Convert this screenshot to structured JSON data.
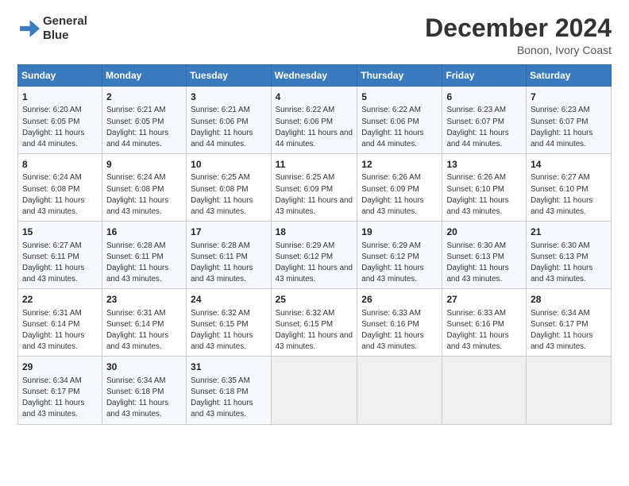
{
  "logo": {
    "line1": "General",
    "line2": "Blue"
  },
  "title": "December 2024",
  "subtitle": "Bonon, Ivory Coast",
  "days_header": [
    "Sunday",
    "Monday",
    "Tuesday",
    "Wednesday",
    "Thursday",
    "Friday",
    "Saturday"
  ],
  "weeks": [
    [
      {
        "day": "1",
        "sunrise": "6:20 AM",
        "sunset": "6:05 PM",
        "daylight": "11 hours and 44 minutes."
      },
      {
        "day": "2",
        "sunrise": "6:21 AM",
        "sunset": "6:05 PM",
        "daylight": "11 hours and 44 minutes."
      },
      {
        "day": "3",
        "sunrise": "6:21 AM",
        "sunset": "6:06 PM",
        "daylight": "11 hours and 44 minutes."
      },
      {
        "day": "4",
        "sunrise": "6:22 AM",
        "sunset": "6:06 PM",
        "daylight": "11 hours and 44 minutes."
      },
      {
        "day": "5",
        "sunrise": "6:22 AM",
        "sunset": "6:06 PM",
        "daylight": "11 hours and 44 minutes."
      },
      {
        "day": "6",
        "sunrise": "6:23 AM",
        "sunset": "6:07 PM",
        "daylight": "11 hours and 44 minutes."
      },
      {
        "day": "7",
        "sunrise": "6:23 AM",
        "sunset": "6:07 PM",
        "daylight": "11 hours and 44 minutes."
      }
    ],
    [
      {
        "day": "8",
        "sunrise": "6:24 AM",
        "sunset": "6:08 PM",
        "daylight": "11 hours and 43 minutes."
      },
      {
        "day": "9",
        "sunrise": "6:24 AM",
        "sunset": "6:08 PM",
        "daylight": "11 hours and 43 minutes."
      },
      {
        "day": "10",
        "sunrise": "6:25 AM",
        "sunset": "6:08 PM",
        "daylight": "11 hours and 43 minutes."
      },
      {
        "day": "11",
        "sunrise": "6:25 AM",
        "sunset": "6:09 PM",
        "daylight": "11 hours and 43 minutes."
      },
      {
        "day": "12",
        "sunrise": "6:26 AM",
        "sunset": "6:09 PM",
        "daylight": "11 hours and 43 minutes."
      },
      {
        "day": "13",
        "sunrise": "6:26 AM",
        "sunset": "6:10 PM",
        "daylight": "11 hours and 43 minutes."
      },
      {
        "day": "14",
        "sunrise": "6:27 AM",
        "sunset": "6:10 PM",
        "daylight": "11 hours and 43 minutes."
      }
    ],
    [
      {
        "day": "15",
        "sunrise": "6:27 AM",
        "sunset": "6:11 PM",
        "daylight": "11 hours and 43 minutes."
      },
      {
        "day": "16",
        "sunrise": "6:28 AM",
        "sunset": "6:11 PM",
        "daylight": "11 hours and 43 minutes."
      },
      {
        "day": "17",
        "sunrise": "6:28 AM",
        "sunset": "6:11 PM",
        "daylight": "11 hours and 43 minutes."
      },
      {
        "day": "18",
        "sunrise": "6:29 AM",
        "sunset": "6:12 PM",
        "daylight": "11 hours and 43 minutes."
      },
      {
        "day": "19",
        "sunrise": "6:29 AM",
        "sunset": "6:12 PM",
        "daylight": "11 hours and 43 minutes."
      },
      {
        "day": "20",
        "sunrise": "6:30 AM",
        "sunset": "6:13 PM",
        "daylight": "11 hours and 43 minutes."
      },
      {
        "day": "21",
        "sunrise": "6:30 AM",
        "sunset": "6:13 PM",
        "daylight": "11 hours and 43 minutes."
      }
    ],
    [
      {
        "day": "22",
        "sunrise": "6:31 AM",
        "sunset": "6:14 PM",
        "daylight": "11 hours and 43 minutes."
      },
      {
        "day": "23",
        "sunrise": "6:31 AM",
        "sunset": "6:14 PM",
        "daylight": "11 hours and 43 minutes."
      },
      {
        "day": "24",
        "sunrise": "6:32 AM",
        "sunset": "6:15 PM",
        "daylight": "11 hours and 43 minutes."
      },
      {
        "day": "25",
        "sunrise": "6:32 AM",
        "sunset": "6:15 PM",
        "daylight": "11 hours and 43 minutes."
      },
      {
        "day": "26",
        "sunrise": "6:33 AM",
        "sunset": "6:16 PM",
        "daylight": "11 hours and 43 minutes."
      },
      {
        "day": "27",
        "sunrise": "6:33 AM",
        "sunset": "6:16 PM",
        "daylight": "11 hours and 43 minutes."
      },
      {
        "day": "28",
        "sunrise": "6:34 AM",
        "sunset": "6:17 PM",
        "daylight": "11 hours and 43 minutes."
      }
    ],
    [
      {
        "day": "29",
        "sunrise": "6:34 AM",
        "sunset": "6:17 PM",
        "daylight": "11 hours and 43 minutes."
      },
      {
        "day": "30",
        "sunrise": "6:34 AM",
        "sunset": "6:18 PM",
        "daylight": "11 hours and 43 minutes."
      },
      {
        "day": "31",
        "sunrise": "6:35 AM",
        "sunset": "6:18 PM",
        "daylight": "11 hours and 43 minutes."
      },
      null,
      null,
      null,
      null
    ]
  ],
  "labels": {
    "sunrise_prefix": "Sunrise: ",
    "sunset_prefix": "Sunset: ",
    "daylight_prefix": "Daylight: "
  }
}
